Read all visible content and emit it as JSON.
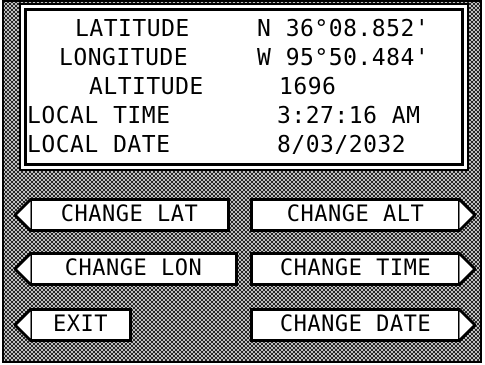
{
  "info_panel": {
    "rows": [
      {
        "label": "LATITUDE",
        "value": "N 36°08.852'"
      },
      {
        "label": "LONGITUDE",
        "value": "W 95°50.484'"
      },
      {
        "label": "ALTITUDE",
        "value": "1696"
      },
      {
        "label": "LOCAL TIME",
        "value": "3:27:16 AM"
      },
      {
        "label": "LOCAL DATE",
        "value": "8/03/2032"
      }
    ]
  },
  "buttons": {
    "change_lat": "CHANGE LAT",
    "change_alt": "CHANGE ALT",
    "change_lon": "CHANGE LON",
    "change_time": "CHANGE TIME",
    "exit": "EXIT",
    "change_date": "CHANGE DATE"
  },
  "colors": {
    "background_pattern": "#bdbdbd",
    "ink": "#000000",
    "paper": "#ffffff"
  }
}
